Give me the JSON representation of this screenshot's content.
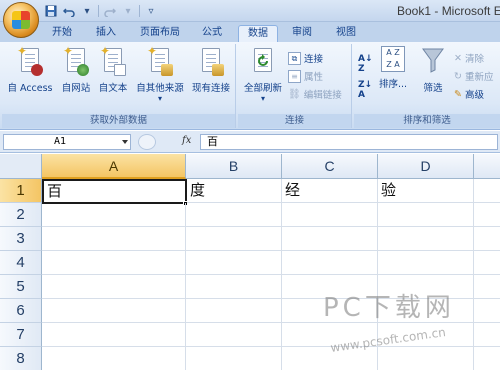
{
  "window": {
    "title": "Book1 - Microsoft E"
  },
  "quick_access": {
    "icons": [
      "save-icon",
      "undo-icon",
      "redo-icon",
      "customize-icon"
    ]
  },
  "tabs": [
    {
      "label": "开始",
      "active": false
    },
    {
      "label": "插入",
      "active": false
    },
    {
      "label": "页面布局",
      "active": false
    },
    {
      "label": "公式",
      "active": false
    },
    {
      "label": "数据",
      "active": true
    },
    {
      "label": "审阅",
      "active": false
    },
    {
      "label": "视图",
      "active": false
    }
  ],
  "ribbon": {
    "groups": [
      {
        "label": "获取外部数据",
        "buttons": [
          {
            "label": "自 Access",
            "icon": "access-icon"
          },
          {
            "label": "自网站",
            "icon": "web-icon"
          },
          {
            "label": "自文本",
            "icon": "text-icon"
          },
          {
            "label": "自其他来源",
            "icon": "other-sources-icon"
          },
          {
            "label": "现有连接",
            "icon": "existing-connections-icon"
          }
        ]
      },
      {
        "label": "连接",
        "big_button": {
          "label": "全部刷新",
          "icon": "refresh-icon"
        },
        "small_buttons": [
          {
            "label": "连接",
            "enabled": true
          },
          {
            "label": "属性",
            "enabled": false
          },
          {
            "label": "编辑链接",
            "enabled": false
          }
        ]
      },
      {
        "label": "排序和筛选",
        "sort_buttons": [
          "sort-asc-icon",
          "sort-desc-icon"
        ],
        "big_buttons": [
          {
            "label": "排序...",
            "icon": "sort-icon"
          },
          {
            "label": "筛选",
            "icon": "filter-icon"
          }
        ],
        "small_buttons": [
          {
            "label": "清除",
            "enabled": false
          },
          {
            "label": "重新应",
            "enabled": false
          },
          {
            "label": "高级",
            "enabled": true
          }
        ]
      }
    ]
  },
  "formula_bar": {
    "name_box": "A1",
    "fx": "fx",
    "content": "百"
  },
  "sheet": {
    "columns": [
      "A",
      "B",
      "C",
      "D"
    ],
    "rows": [
      "1",
      "2",
      "3",
      "4",
      "5",
      "6",
      "7",
      "8"
    ],
    "row1": [
      "百",
      "度",
      "经",
      "验"
    ],
    "active_cell": "A1"
  },
  "watermark": {
    "big": "PC下载网",
    "url": "www.pcsoft.com.cn"
  }
}
